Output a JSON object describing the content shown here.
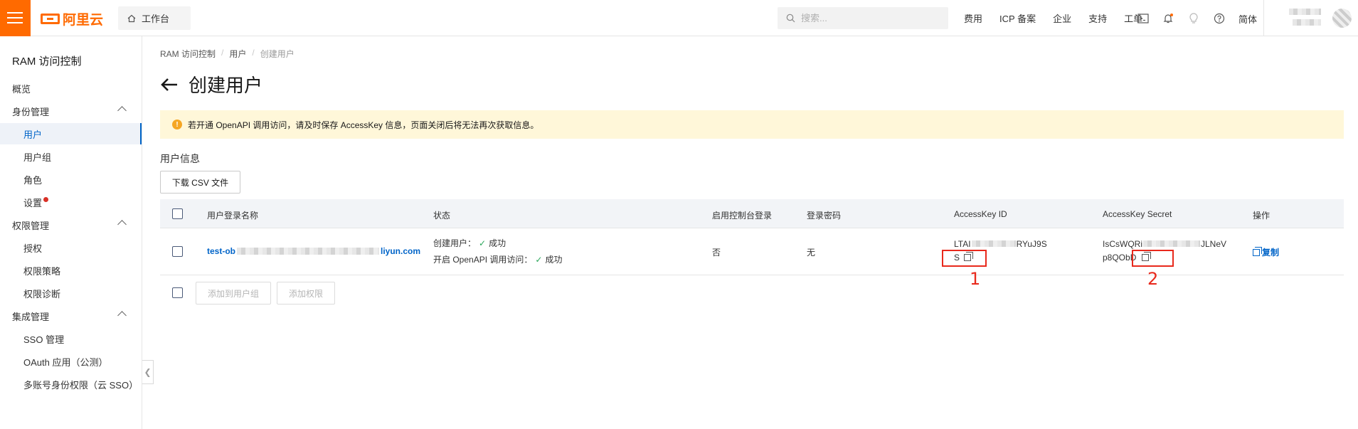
{
  "header": {
    "logo_text": "阿里云",
    "workbench": "工作台",
    "search_placeholder": "搜索...",
    "nav": [
      "费用",
      "ICP 备案",
      "企业",
      "支持",
      "工单"
    ],
    "lang": "简体"
  },
  "sidebar": {
    "title": "RAM 访问控制",
    "overview": "概览",
    "identity": "身份管理",
    "users": "用户",
    "groups": "用户组",
    "roles": "角色",
    "settings": "设置",
    "perm": "权限管理",
    "grant": "授权",
    "policy": "权限策略",
    "diag": "权限诊断",
    "integ": "集成管理",
    "sso": "SSO 管理",
    "oauth": "OAuth 应用（公测）",
    "multi": "多账号身份权限（云 SSO）"
  },
  "breadcrumb": [
    "RAM 访问控制",
    "用户",
    "创建用户"
  ],
  "page_title": "创建用户",
  "notice": "若开通 OpenAPI 调用访问，请及时保存 AccessKey 信息，页面关闭后将无法再次获取信息。",
  "section_title": "用户信息",
  "download_button": "下载 CSV 文件",
  "table": {
    "headers": {
      "name": "用户登录名称",
      "status": "状态",
      "console": "启用控制台登录",
      "password": "登录密码",
      "akid": "AccessKey ID",
      "secret": "AccessKey Secret",
      "ops": "操作"
    },
    "row": {
      "name_prefix": "test-ob",
      "name_suffix": "liyun.com",
      "status1_label": "创建用户：",
      "status1_value": "成功",
      "status2_label": "开启 OpenAPI 调用访问：",
      "status2_value": "成功",
      "console": "否",
      "password": "无",
      "akid_l1_prefix": "LTAI",
      "akid_l1_suffix": "RYuJ9S",
      "akid_l2": "S",
      "secret_l1_prefix": "IsCsWQRi",
      "secret_l1_suffix": "JLNeV",
      "secret_l2": "p8QObD",
      "copy": "复制"
    }
  },
  "footer_buttons": {
    "add_group": "添加到用户组",
    "add_perm": "添加权限"
  },
  "annotations": [
    "1",
    "2"
  ],
  "colors": {
    "brand": "#ff6a00",
    "link": "#0064c8",
    "annotation": "#e8291c",
    "notice_bg": "#fff7d9"
  }
}
